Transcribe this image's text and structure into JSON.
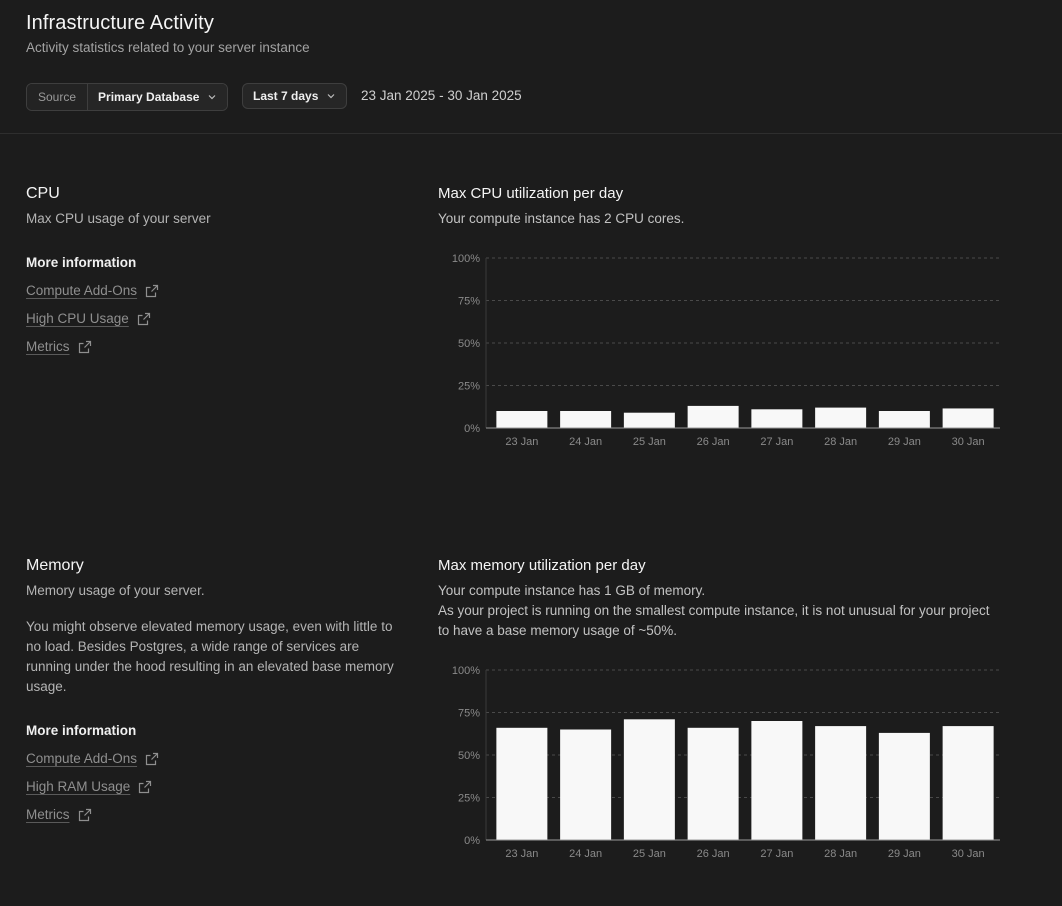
{
  "header": {
    "title": "Infrastructure Activity",
    "subtitle": "Activity statistics related to your server instance",
    "source_label": "Source",
    "source_value": "Primary Database",
    "range_value": "Last 7 days",
    "date_range": "23 Jan 2025 - 30 Jan 2025"
  },
  "cpu": {
    "title": "CPU",
    "description": "Max CPU usage of your server",
    "more_info": "More information",
    "links": [
      "Compute Add-Ons",
      "High CPU Usage",
      "Metrics"
    ],
    "chart_title": "Max CPU utilization per day",
    "chart_desc": "Your compute instance has 2 CPU cores."
  },
  "memory": {
    "title": "Memory",
    "description": "Memory usage of your server.",
    "description_2": "You might observe elevated memory usage, even with little to no load. Besides Postgres, a wide range of services are running under the hood resulting in an elevated base memory usage.",
    "more_info": "More information",
    "links": [
      "Compute Add-Ons",
      "High RAM Usage",
      "Metrics"
    ],
    "chart_title": "Max memory utilization per day",
    "chart_desc_1": "Your compute instance has 1 GB of memory.",
    "chart_desc_2": "As your project is running on the smallest compute instance, it is not unusual for your project to have a base memory usage of ~50%."
  },
  "icons": {
    "dropdown": "chevron-down-icon",
    "external_link": "external-link-icon"
  },
  "colors": {
    "background": "#1c1c1c",
    "bar": "#f8f8f8",
    "grid": "#4a4a4a"
  },
  "chart_data": [
    {
      "type": "bar",
      "categories": [
        "23 Jan",
        "24 Jan",
        "25 Jan",
        "26 Jan",
        "27 Jan",
        "28 Jan",
        "29 Jan",
        "30 Jan"
      ],
      "values": [
        10,
        10,
        9,
        13,
        11,
        12,
        10,
        11.5
      ],
      "yticks": [
        "0%",
        "25%",
        "50%",
        "75%",
        "100%"
      ],
      "ylim": [
        0,
        100
      ],
      "grid": true
    },
    {
      "type": "bar",
      "categories": [
        "23 Jan",
        "24 Jan",
        "25 Jan",
        "26 Jan",
        "27 Jan",
        "28 Jan",
        "29 Jan",
        "30 Jan"
      ],
      "values": [
        66,
        65,
        71,
        66,
        70,
        67,
        63,
        67
      ],
      "yticks": [
        "0%",
        "25%",
        "50%",
        "75%",
        "100%"
      ],
      "ylim": [
        0,
        100
      ],
      "grid": true
    }
  ]
}
